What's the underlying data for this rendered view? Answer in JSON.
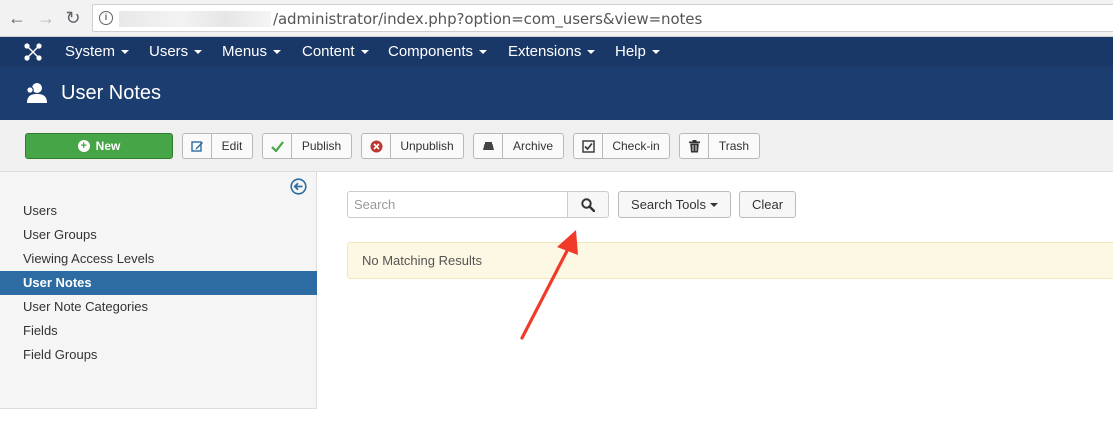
{
  "browser": {
    "back_icon": "arrow-left-icon",
    "forward_icon": "arrow-right-icon",
    "reload_icon": "reload-icon",
    "info_icon": "info-icon",
    "url": "/administrator/index.php?option=com_users&view=notes"
  },
  "navbar": {
    "logo": "joomla-logo",
    "items": [
      {
        "label": "System"
      },
      {
        "label": "Users"
      },
      {
        "label": "Menus"
      },
      {
        "label": "Content"
      },
      {
        "label": "Components"
      },
      {
        "label": "Extensions"
      },
      {
        "label": "Help"
      }
    ]
  },
  "header": {
    "icon": "user-notes-icon",
    "title": "User Notes"
  },
  "toolbar": {
    "new_label": "New",
    "edit_label": "Edit",
    "publish_label": "Publish",
    "unpublish_label": "Unpublish",
    "archive_label": "Archive",
    "checkin_label": "Check-in",
    "trash_label": "Trash"
  },
  "sidebar": {
    "collapse_icon": "collapse-left-icon",
    "items": [
      {
        "label": "Users"
      },
      {
        "label": "User Groups"
      },
      {
        "label": "Viewing Access Levels"
      },
      {
        "label": "User Notes",
        "active": true
      },
      {
        "label": "User Note Categories"
      },
      {
        "label": "Fields"
      },
      {
        "label": "Field Groups"
      }
    ]
  },
  "main": {
    "search_placeholder": "Search",
    "search_tools_label": "Search Tools",
    "clear_label": "Clear",
    "no_results": "No Matching Results"
  },
  "colors": {
    "navbar": "#1a3867",
    "header": "#1c3d6f",
    "new_button": "#46a546",
    "sidebar_active": "#2d6ca2",
    "alert_bg": "#fcf8e3",
    "annotation_arrow": "#f03a2a"
  }
}
